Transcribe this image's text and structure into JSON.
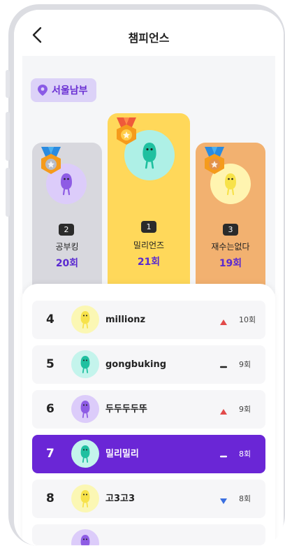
{
  "header": {
    "title": "챔피언스"
  },
  "region": {
    "label": "서울남부"
  },
  "podium": [
    {
      "rank": "1",
      "name": "밀리언즈",
      "count": "21회",
      "bg": "#ffd85a",
      "avatar_bg": "#aef0e6",
      "char": "#1fc0a0",
      "medal": "gold"
    },
    {
      "rank": "2",
      "name": "공부킹",
      "count": "20회",
      "bg": "#d8d8de",
      "avatar_bg": "#dcccfa",
      "char": "#8e5ce4",
      "medal": "silver"
    },
    {
      "rank": "3",
      "name": "재수는없다",
      "count": "19회",
      "bg": "#f2b170",
      "avatar_bg": "#fff4b0",
      "char": "#f7e24a",
      "medal": "bronze"
    }
  ],
  "ranking": [
    {
      "rank": "4",
      "name": "millionz",
      "trend": "up",
      "count": "10회",
      "avatar_bg": "#fbf7b4",
      "char": "#f7e24a"
    },
    {
      "rank": "5",
      "name": "gongbuking",
      "trend": "same",
      "count": "9회",
      "avatar_bg": "#c4f4ec",
      "char": "#1fc0a0"
    },
    {
      "rank": "6",
      "name": "두두두두뚜",
      "trend": "up",
      "count": "9회",
      "avatar_bg": "#dcccfa",
      "char": "#8e5ce4"
    },
    {
      "rank": "7",
      "name": "밀리밀리",
      "trend": "same",
      "count": "8회",
      "avatar_bg": "#c4f4ec",
      "char": "#1fc0a0",
      "me": true
    },
    {
      "rank": "8",
      "name": "고3고3",
      "trend": "down",
      "count": "8회",
      "avatar_bg": "#fbf7b4",
      "char": "#f7e24a"
    }
  ],
  "colors": {
    "accent": "#6a26d6",
    "up": "#e24a4a",
    "down": "#3a6fe0"
  }
}
